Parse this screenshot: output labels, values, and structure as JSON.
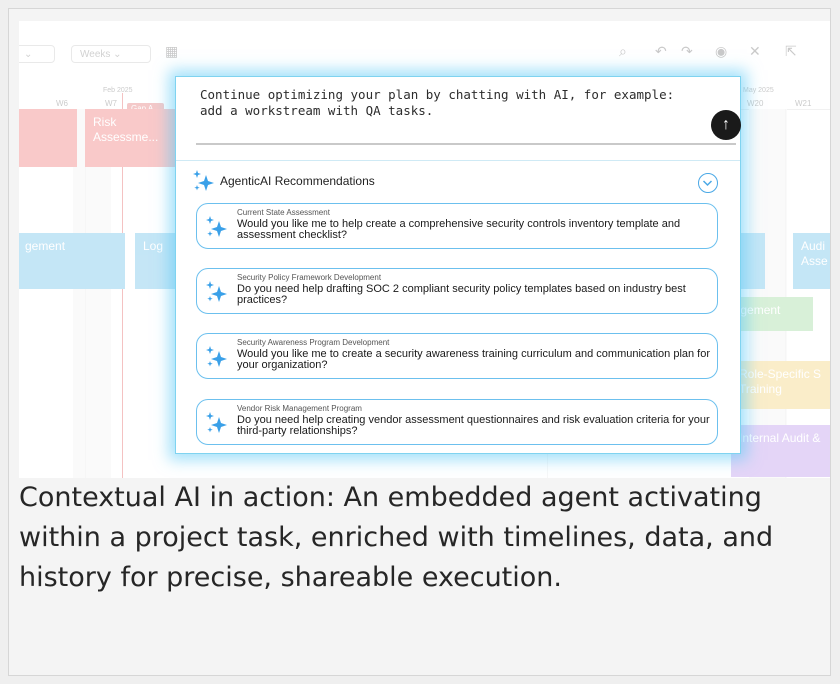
{
  "toolbar": {
    "view_select": "Weeks",
    "icons": [
      "search-icon",
      "undo-icon",
      "redo-icon",
      "eye-icon",
      "tools-icon",
      "share-icon"
    ]
  },
  "timeline": {
    "months": [
      "Feb 2025",
      "May 2025"
    ],
    "weeks": [
      "W6",
      "W7",
      "W20",
      "W21"
    ],
    "gap_tag": "Gap A...",
    "bars": {
      "risk": "Risk Assessme...",
      "engagement": "gement",
      "log": "Log",
      "audit": "Audi Asse",
      "management": "nagement",
      "role_training": "Role-Specific S Training",
      "internal_audit": "Internal Audit &"
    }
  },
  "chat": {
    "text": "Continue optimizing your plan by chatting with AI, for example: add a workstream with QA tasks.",
    "send_icon": "arrow-up-icon"
  },
  "recommendations": {
    "title": "AgenticAI Recommendations",
    "items": [
      {
        "label": "Current State Assessment",
        "text": "Would you like me to help create a comprehensive security controls inventory template and assessment checklist?"
      },
      {
        "label": "Security Policy Framework Development",
        "text": "Do you need help drafting SOC 2 compliant security policy templates based on industry best practices?"
      },
      {
        "label": "Security Awareness Program Development",
        "text": "Would you like me to create a security awareness training curriculum and communication plan for your organization?"
      },
      {
        "label": "Vendor Risk Management Program",
        "text": "Do you need help creating vendor assessment questionnaires and risk evaluation criteria for your third-party relationships?"
      }
    ]
  },
  "caption": "Contextual AI in action: An embedded agent activating within a project task, enriched with timelines, data, and history for precise, shareable execution.",
  "colors": {
    "accent": "#4aa8e6",
    "glow": "#5ac8f5",
    "risk_bar": "#f28a8a",
    "engagement_bar": "#7ec8ec",
    "management_bar": "#a9dfa9",
    "training_bar": "#f6d98a",
    "audit_bar": "#c4a4ef"
  }
}
